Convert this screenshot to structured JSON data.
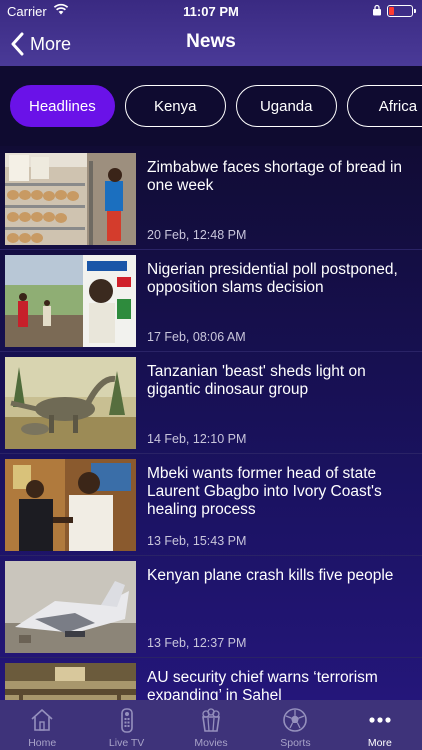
{
  "status_bar": {
    "carrier": "Carrier",
    "time": "11:07 PM"
  },
  "nav": {
    "back_label": "More",
    "title": "News"
  },
  "chips": [
    {
      "label": "Headlines",
      "active": true
    },
    {
      "label": "Kenya",
      "active": false
    },
    {
      "label": "Uganda",
      "active": false
    },
    {
      "label": "Africa",
      "active": false
    }
  ],
  "articles": [
    {
      "headline": "Zimbabwe faces shortage of bread in one week",
      "date": "20 Feb, 12:48 PM",
      "thumbnail": "bread-shelves-photo"
    },
    {
      "headline": "Nigerian presidential poll postponed, opposition slams decision",
      "date": "17 Feb, 08:06 AM",
      "thumbnail": "election-poster-photo"
    },
    {
      "headline": "Tanzanian 'beast' sheds light on gigantic dinosaur group",
      "date": "14 Feb, 12:10 PM",
      "thumbnail": "dinosaur-illustration"
    },
    {
      "headline": "Mbeki wants former head of state Laurent Gbagbo into Ivory Coast's healing process",
      "date": "13 Feb, 15:43 PM",
      "thumbnail": "handshake-photo"
    },
    {
      "headline": "Kenyan plane crash kills five people",
      "date": "13 Feb, 12:37 PM",
      "thumbnail": "plane-wreck-photo"
    },
    {
      "headline": "AU security chief warns ‘terrorism expanding’ in Sahel",
      "date": "",
      "thumbnail": "conference-hall-photo"
    }
  ],
  "tabs": [
    {
      "label": "Home",
      "icon": "house-icon",
      "active": false
    },
    {
      "label": "Live TV",
      "icon": "remote-control-icon",
      "active": false
    },
    {
      "label": "Movies",
      "icon": "popcorn-icon",
      "active": false
    },
    {
      "label": "Sports",
      "icon": "soccer-ball-icon",
      "active": false
    },
    {
      "label": "More",
      "icon": "more-dots-icon",
      "active": true
    }
  ],
  "colors": {
    "nav_background": "#3a2a82",
    "active_chip": "#6a12e8",
    "tabbar_background": "#3e337a",
    "battery_low": "#ff3b30"
  }
}
